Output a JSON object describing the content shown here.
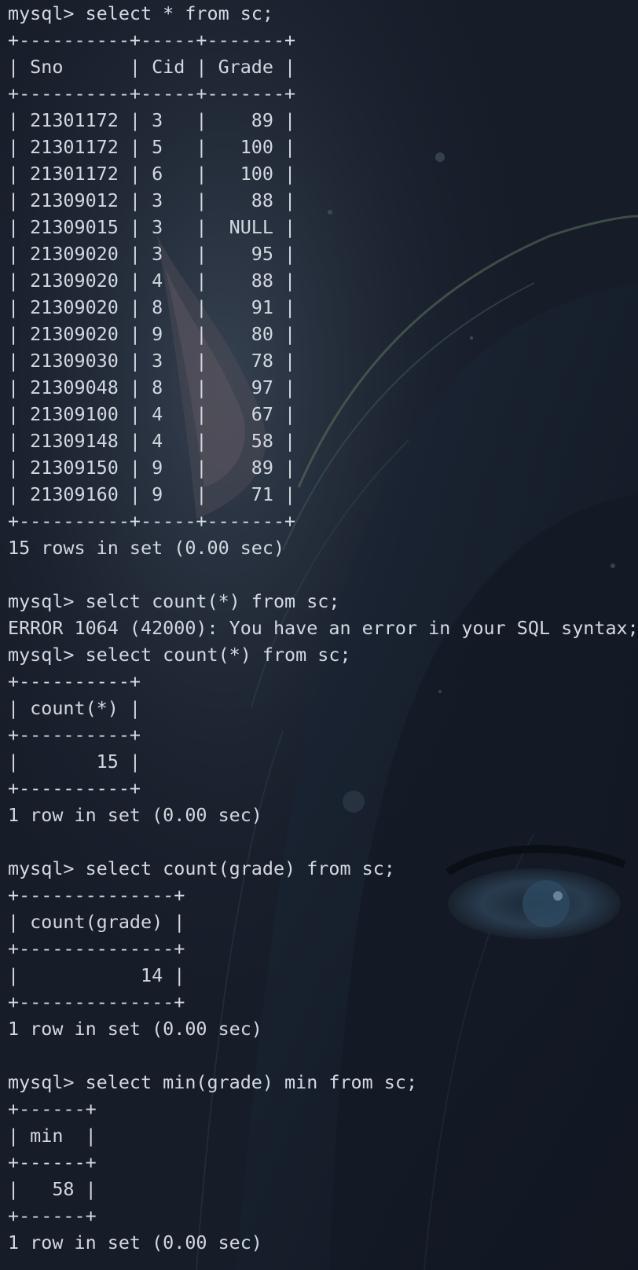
{
  "colors": {
    "background": "#1a2030",
    "text": "#d3d8e1"
  },
  "terminal": {
    "lines": [
      "mysql> select * from sc;",
      "+----------+-----+-------+",
      "| Sno      | Cid | Grade |",
      "+----------+-----+-------+",
      "| 21301172 | 3   |    89 |",
      "| 21301172 | 5   |   100 |",
      "| 21301172 | 6   |   100 |",
      "| 21309012 | 3   |    88 |",
      "| 21309015 | 3   |  NULL |",
      "| 21309020 | 3   |    95 |",
      "| 21309020 | 4   |    88 |",
      "| 21309020 | 8   |    91 |",
      "| 21309020 | 9   |    80 |",
      "| 21309030 | 3   |    78 |",
      "| 21309048 | 8   |    97 |",
      "| 21309100 | 4   |    67 |",
      "| 21309148 | 4   |    58 |",
      "| 21309150 | 9   |    89 |",
      "| 21309160 | 9   |    71 |",
      "+----------+-----+-------+",
      "15 rows in set (0.00 sec)",
      "",
      "mysql> selct count(*) from sc;",
      "ERROR 1064 (42000): You have an error in your SQL syntax;",
      "mysql> select count(*) from sc;",
      "+----------+",
      "| count(*) |",
      "+----------+",
      "|       15 |",
      "+----------+",
      "1 row in set (0.00 sec)",
      "",
      "mysql> select count(grade) from sc;",
      "+--------------+",
      "| count(grade) |",
      "+--------------+",
      "|           14 |",
      "+--------------+",
      "1 row in set (0.00 sec)",
      "",
      "mysql> select min(grade) min from sc;",
      "+------+",
      "| min  |",
      "+------+",
      "|   58 |",
      "+------+",
      "1 row in set (0.00 sec)"
    ]
  }
}
